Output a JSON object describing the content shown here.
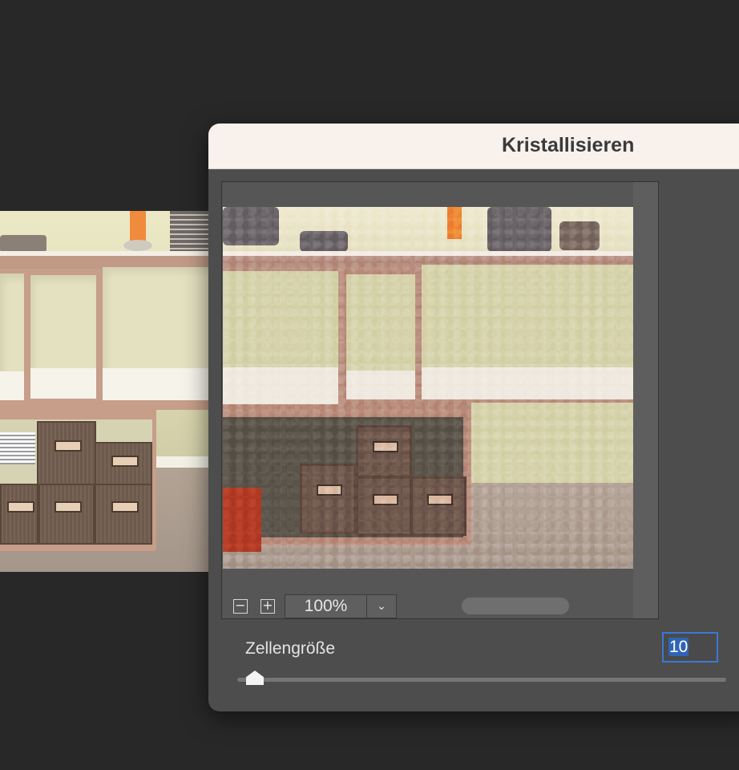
{
  "dialog": {
    "title": "Kristallisieren",
    "zoom": {
      "value": "100%",
      "zoom_out_symbol": "−",
      "zoom_in_symbol": "+",
      "dropdown_symbol": "⌄"
    },
    "parameter": {
      "label": "Zellengröße",
      "value": "10",
      "slider_fraction": 0.02
    }
  },
  "icons": [
    "zoom-out-icon",
    "zoom-in-icon",
    "chevron-down-icon"
  ],
  "colors": {
    "titlebar": "#f9f1ec",
    "dialog_body": "#4d4d4d",
    "selection": "#2f64b5",
    "focus_ring": "#3b78d4"
  }
}
